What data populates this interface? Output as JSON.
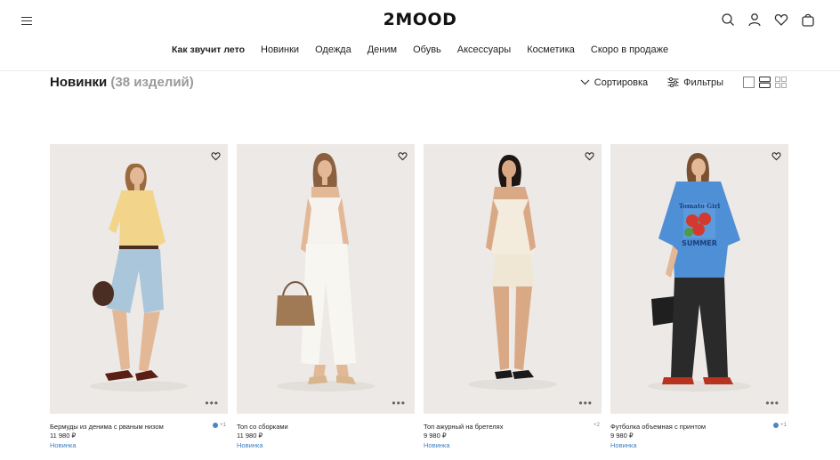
{
  "header": {
    "logo": "2MOOD",
    "icons": [
      "menu-icon",
      "search-icon",
      "account-icon",
      "favorites-icon",
      "bag-icon"
    ]
  },
  "nav": {
    "items": [
      "Как звучит лето",
      "Новинки",
      "Одежда",
      "Деним",
      "Обувь",
      "Аксессуары",
      "Косметика",
      "Скоро в продаже"
    ]
  },
  "page": {
    "title": "Новинки",
    "count": "(38 изделий)",
    "sort_label": "Сортировка",
    "filter_label": "Фильтры"
  },
  "products": [
    {
      "name": "Бермуды из денима с рваным низом",
      "price": "11 980 ₽",
      "badge": "Новинка",
      "swatch_more": "+1",
      "swatch_color": "#4a86c5"
    },
    {
      "name": "Топ со сборками",
      "price": "11 980 ₽",
      "badge": "Новинка",
      "swatch_more": "",
      "swatch_color": ""
    },
    {
      "name": "Топ ажурный на бретелях",
      "price": "9 980 ₽",
      "badge": "Новинка",
      "swatch_more": "+2",
      "swatch_color": ""
    },
    {
      "name": "Футболка объемная с принтом",
      "price": "9 980 ₽",
      "badge": "Новинка",
      "swatch_more": "+1",
      "swatch_color": "#4a86c5"
    }
  ],
  "print_text": {
    "top": "Tomato Girl",
    "bottom": "SUMMER"
  },
  "colors": {
    "accent": "#3d7fc4",
    "photo_bg": "#ece9e6"
  }
}
